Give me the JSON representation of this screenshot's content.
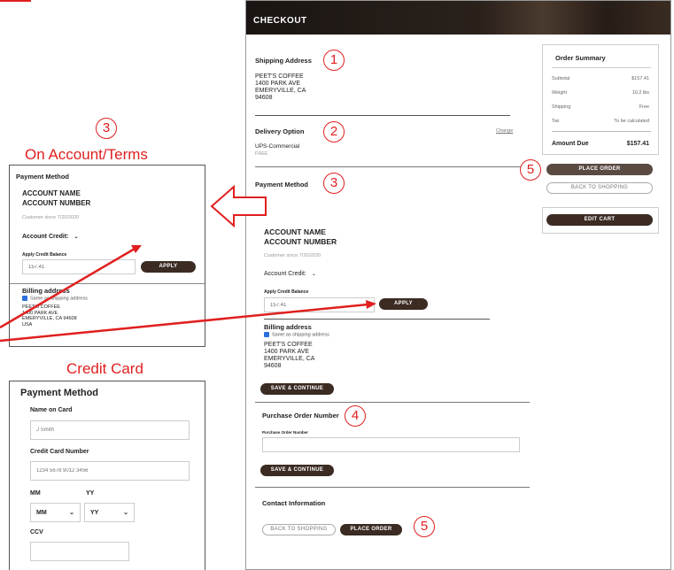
{
  "checkout": {
    "header": "CHECKOUT",
    "shipping": {
      "title": "Shipping Address",
      "lines": [
        "PEET'S COFFEE",
        "1400 PARK AVE",
        "EMERYVILLE, CA",
        "94608"
      ]
    },
    "delivery": {
      "title": "Delivery Option",
      "change": "Change",
      "method": "UPS-Commercial",
      "price": "FREE"
    },
    "payment": {
      "title": "Payment Method",
      "account_name": "ACCOUNT NAME",
      "account_number": "ACCOUNT NUMBER",
      "customer_since": "Customer since 7/20/2020",
      "account_credit": "Account Credit:",
      "apply_label": "Apply Credit Balance",
      "apply_value": "157.41",
      "apply_button": "APPLY",
      "billing_title": "Billing address",
      "same_as": "Same as shipping address",
      "billing_lines": [
        "PEET'S COFFEE",
        "1400 PARK AVE",
        "EMERYVILLE, CA",
        "94608"
      ],
      "save_button": "SAVE & CONTINUE"
    },
    "po": {
      "title": "Purchase Order Number",
      "label": "Purchase Order Number",
      "save_button": "SAVE & CONTINUE"
    },
    "contact": {
      "title": "Contact Information"
    },
    "bottom": {
      "back": "BACK TO SHOPPING",
      "place": "PLACE ORDER"
    },
    "summary": {
      "title": "Order Summary",
      "rows": [
        {
          "label": "Subtotal",
          "value": "$157.41"
        },
        {
          "label": "Weight",
          "value": "10.2 lbs"
        },
        {
          "label": "Shipping",
          "value": "Free"
        },
        {
          "label": "Tax",
          "value": "To be calculated"
        }
      ],
      "amount_label": "Amount Due",
      "amount_value": "$157.41",
      "place": "PLACE ORDER",
      "back": "BACK TO SHOPPING",
      "edit": "EDIT CART"
    }
  },
  "badges": {
    "one": "1",
    "two": "2",
    "three": "3",
    "four": "4",
    "five": "5"
  },
  "account_panel": {
    "caption": "On Account/Terms",
    "title": "Payment Method",
    "account_name": "ACCOUNT NAME",
    "account_number": "ACCOUNT NUMBER",
    "customer_since": "Customer since 7/20/2020",
    "account_credit": "Account Credit:",
    "apply_label": "Apply Credit Balance",
    "apply_value": "157.41",
    "apply_button": "APPLY",
    "billing_title": "Billing address",
    "same_as": "Same as shipping address",
    "billing_lines": [
      "PEET'S COFFEE",
      "1400 PARK AVE",
      "EMERYVILLE, CA 94608",
      "USA"
    ]
  },
  "card_panel": {
    "caption": "Credit Card",
    "title": "Payment Method",
    "name_label": "Name on Card",
    "name_placeholder": "J Smith",
    "number_label": "Credit Card Number",
    "number_placeholder": "1234 5678 9012 3456",
    "mm_label": "MM",
    "yy_label": "YY",
    "mm_value": "MM",
    "yy_value": "YY",
    "ccv_label": "CCV"
  },
  "colors": {
    "accent": "#e01f1f",
    "dark_button": "#3b2b22",
    "checkbox": "#2a6fdb"
  }
}
